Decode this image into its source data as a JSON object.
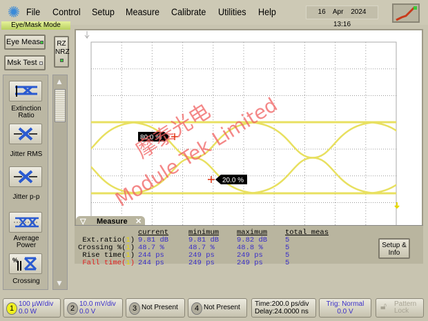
{
  "menu": {
    "items": [
      "File",
      "Control",
      "Setup",
      "Measure",
      "Calibrate",
      "Utilities",
      "Help"
    ],
    "date": "16 Apr 2024",
    "time": "13:16"
  },
  "mode": "Eye/Mask Mode",
  "left": {
    "eye_meas": "Eye Meas",
    "msk_test": "Msk Test",
    "rz": "RZ",
    "nrz": "NRZ"
  },
  "tools": [
    {
      "label": "Extinction Ratio"
    },
    {
      "label": "Jitter RMS"
    },
    {
      "label": "Jitter p-p"
    },
    {
      "label": "Average Power"
    },
    {
      "label": "Crossing Percentage"
    }
  ],
  "markers": {
    "upper": "80.0 %",
    "lower": "20.0 %"
  },
  "watermark": {
    "cn": "摩泰光电",
    "en": "Module Tek Limited"
  },
  "measure": {
    "title": "Measure",
    "headers": [
      "current",
      "minimum",
      "maximum",
      "total meas"
    ],
    "rows": [
      {
        "name": "Ext.ratio",
        "ch": "1",
        "current": "9.81 dB",
        "minimum": "9.81 dB",
        "maximum": "9.82 dB",
        "total": "5"
      },
      {
        "name": "Crossing %",
        "ch": "1",
        "current": "48.7 %",
        "minimum": "48.7 %",
        "maximum": "48.8 %",
        "total": "5"
      },
      {
        "name": "Rise time",
        "ch": "1",
        "current": "244 ps",
        "minimum": "249 ps",
        "maximum": "249 ps",
        "total": "5"
      },
      {
        "name": "Fall time",
        "ch": "1",
        "current": "244 ps",
        "minimum": "249 ps",
        "maximum": "249 ps",
        "total": "5"
      }
    ],
    "setup_info": "Setup & Info"
  },
  "bottom": {
    "ch1": {
      "n": "1",
      "scale": "100 µW/div",
      "offset": "0.0 W"
    },
    "ch2": {
      "n": "2",
      "scale": "10.0 mV/div",
      "offset": "0.0 V"
    },
    "ch3": {
      "n": "3",
      "label": "Not Present"
    },
    "ch4": {
      "n": "4",
      "label": "Not Present"
    },
    "time": "Time:200.0 ps/div",
    "delay": "Delay:24.0000 ns",
    "trig": "Trig: Normal",
    "trig_level": "0.0 V",
    "pattern_lock": "Pattern Lock"
  },
  "colors": {
    "trace": "#e8e060",
    "values": "#3a2fc8",
    "fall_label": "#e02020",
    "watermark": "#f06060"
  }
}
